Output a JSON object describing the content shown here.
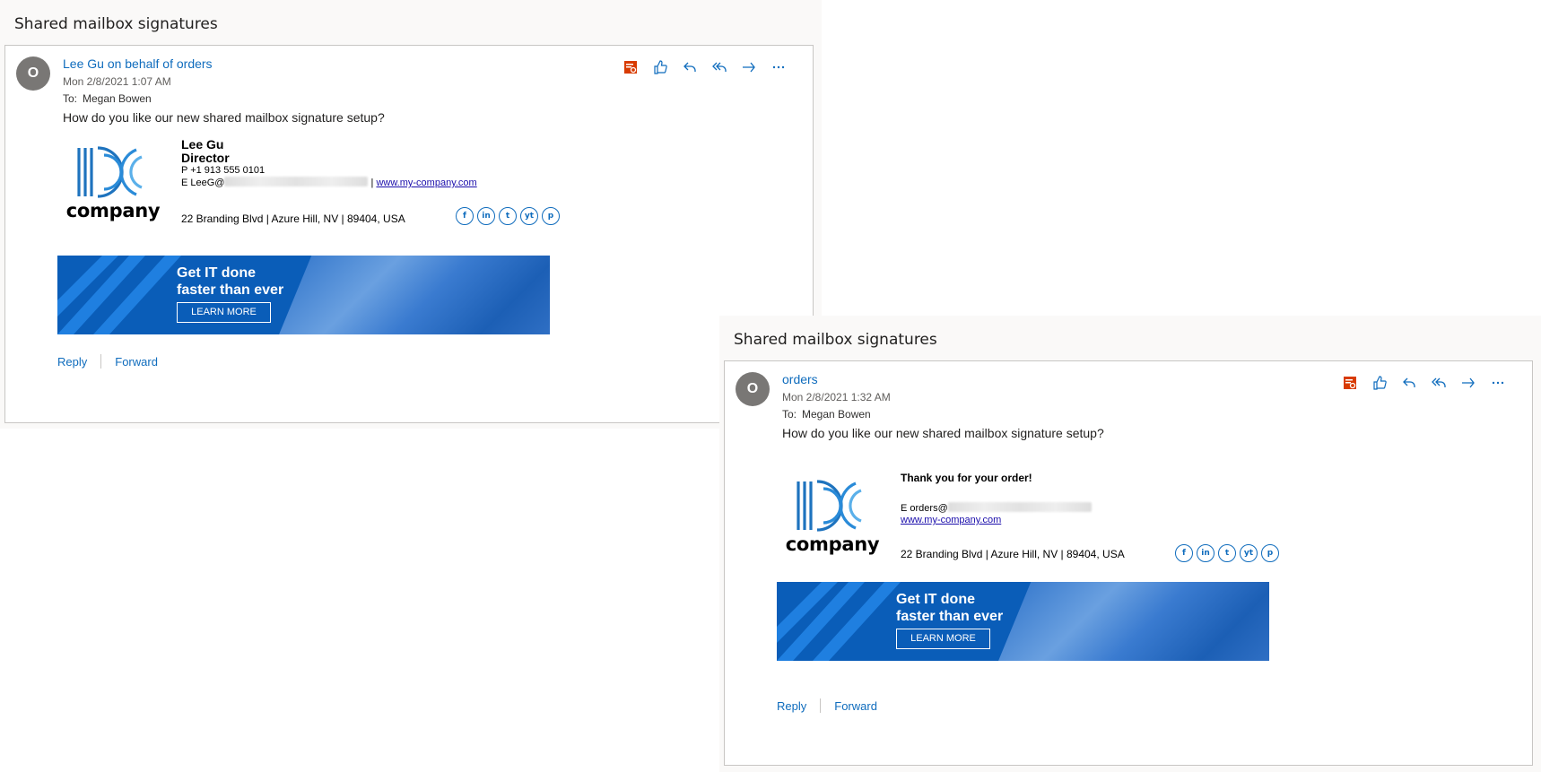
{
  "panes": [
    {
      "title": "Shared mailbox signatures",
      "message": {
        "avatar_initial": "O",
        "sender": "Lee Gu on behalf of orders",
        "date": "Mon 2/8/2021 1:07 AM",
        "to_label": "To:",
        "to": "Megan Bowen",
        "body": "How do you like our new shared mailbox signature setup?",
        "signature": {
          "logo_text": "company",
          "name": "Lee Gu",
          "title": "Director",
          "phone": "P +1 913 555 0101",
          "email_prefix": "E LeeG@",
          "separator": "|",
          "website": "www.my-company.com",
          "address": "22 Branding Blvd | Azure Hill, NV | 89404, USA"
        },
        "banner": {
          "line1": "Get IT done",
          "line2": "faster than ever",
          "button": "LEARN MORE"
        },
        "reply": "Reply",
        "forward": "Forward"
      }
    },
    {
      "title": "Shared mailbox signatures",
      "message": {
        "avatar_initial": "O",
        "sender": "orders",
        "date": "Mon 2/8/2021 1:32 AM",
        "to_label": "To:",
        "to": "Megan Bowen",
        "body": "How do you like our new shared mailbox signature setup?",
        "signature": {
          "logo_text": "company",
          "thanks": "Thank you for your order!",
          "email_prefix": "E orders@",
          "website": "www.my-company.com",
          "address": "22 Branding Blvd | Azure Hill, NV | 89404, USA"
        },
        "banner": {
          "line1": "Get IT done",
          "line2": "faster than ever",
          "button": "LEARN MORE"
        },
        "reply": "Reply",
        "forward": "Forward"
      }
    }
  ],
  "social": [
    "f",
    "in",
    "t",
    "yt",
    "p"
  ],
  "icons": [
    "translate-icon",
    "like-icon",
    "reply-icon",
    "reply-all-icon",
    "forward-icon",
    "more-icon"
  ],
  "colors": {
    "accent": "#0f6cbd",
    "avatar": "#797775",
    "banner": "#0a5db8",
    "icon_orange": "#d83b01"
  }
}
